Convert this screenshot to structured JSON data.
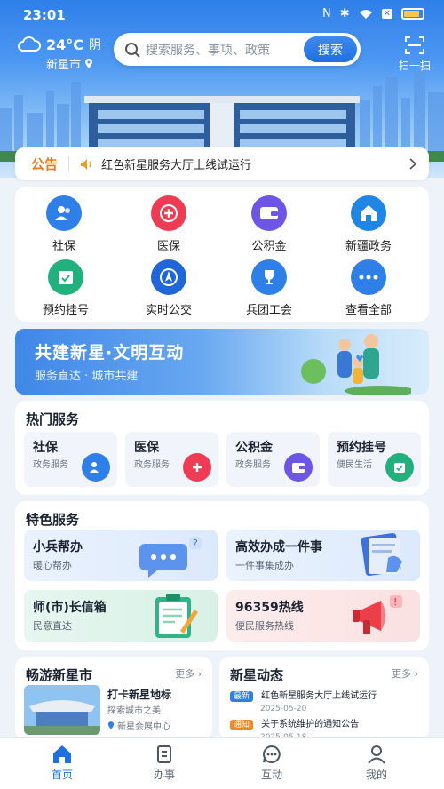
{
  "status": {
    "time": "23:01"
  },
  "weather": {
    "temp": "24°C",
    "condition": "阴",
    "city": "新星市"
  },
  "search": {
    "placeholder": "搜索服务、事项、政策",
    "button": "搜索"
  },
  "scan": {
    "label": "扫一扫"
  },
  "notice": {
    "tag": "公告",
    "text": "红色新星服务大厅上线试运行"
  },
  "grid": [
    {
      "label": "社保",
      "icon": "people-icon",
      "color": "#2f7fe9"
    },
    {
      "label": "医保",
      "icon": "plus-icon",
      "color": "#f03b55"
    },
    {
      "label": "公积金",
      "icon": "wallet-icon",
      "color": "#6d56e6"
    },
    {
      "label": "新疆政务",
      "icon": "home-icon",
      "color": "#1f86e6"
    },
    {
      "label": "预约挂号",
      "icon": "calendar-icon",
      "color": "#22b07d"
    },
    {
      "label": "实时公交",
      "icon": "compass-icon",
      "color": "#1f66d8"
    },
    {
      "label": "兵团工会",
      "icon": "trophy-icon",
      "color": "#2f7fe9"
    },
    {
      "label": "查看全部",
      "icon": "more-icon",
      "color": "#2f7fe9"
    }
  ],
  "banner": {
    "title": "共建新星·文明互动",
    "subtitle": "服务直达 · 城市共建"
  },
  "hot": {
    "title": "热门服务",
    "items": [
      {
        "name": "社保",
        "sub": "政务服务"
      },
      {
        "name": "医保",
        "sub": "政务服务"
      },
      {
        "name": "公积金",
        "sub": "政务服务"
      },
      {
        "name": "预约挂号",
        "sub": "便民生活"
      }
    ]
  },
  "featured": {
    "title": "特色服务",
    "items": [
      {
        "name": "小兵帮办",
        "sub": "暖心帮办"
      },
      {
        "name": "高效办成一件事",
        "sub": "一件事集成办"
      },
      {
        "name": "师(市)长信箱",
        "sub": "民意直达"
      },
      {
        "name": "96359热线",
        "sub": "便民服务热线"
      }
    ]
  },
  "tour": {
    "title": "畅游新星市",
    "more": "更多",
    "item_title": "打卡新星地标",
    "item_sub": "探索城市之美",
    "location": "新星会展中心"
  },
  "news": {
    "title": "新星动态",
    "more": "更多",
    "items": [
      {
        "tag": "最新",
        "title": "红色新星服务大厅上线试运行",
        "date": "2025-05-20"
      },
      {
        "tag": "通知",
        "title": "关于系统维护的通知公告",
        "date": "2025-05-18"
      }
    ]
  },
  "tabs": [
    {
      "label": "首页"
    },
    {
      "label": "办事"
    },
    {
      "label": "互动"
    },
    {
      "label": "我的"
    }
  ]
}
